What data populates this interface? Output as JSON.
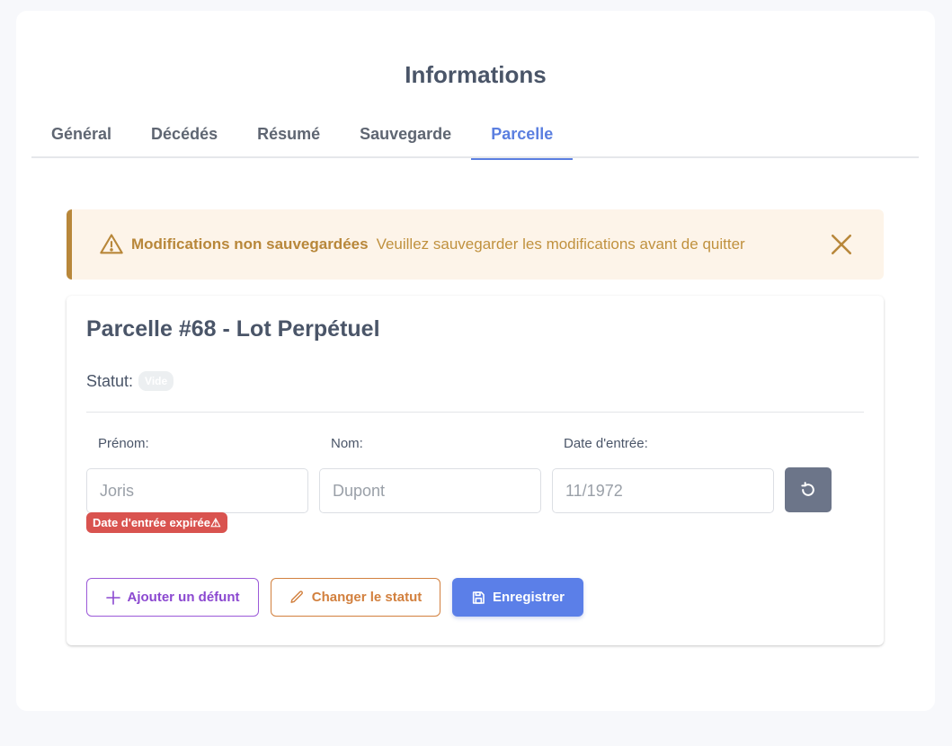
{
  "header": {
    "title": "Informations"
  },
  "tabs": [
    {
      "label": "Général"
    },
    {
      "label": "Décédés"
    },
    {
      "label": "Résumé"
    },
    {
      "label": "Sauvegarde"
    },
    {
      "label": "Parcelle"
    }
  ],
  "active_tab": "Parcelle",
  "alert": {
    "title": "Modifications non sauvegardées",
    "message": "Veuillez sauvegarder les modifications avant de quitter",
    "icon": "warning-triangle-icon",
    "close_icon": "close-icon",
    "color": "#b8873a",
    "background": "#fdf4e9"
  },
  "parcel": {
    "title": "Parcelle #68 - Lot Perpétuel",
    "status_label": "Statut:",
    "status_value": "Vide",
    "fields": {
      "first_name": {
        "label": "Prénom:",
        "value": "Joris"
      },
      "last_name": {
        "label": "Nom:",
        "value": "Dupont"
      },
      "entry_date": {
        "label": "Date d'entrée:",
        "value": "11/1972"
      }
    },
    "reset_icon": "reset-icon",
    "expired_badge": "Date d'entrée expirée⚠"
  },
  "actions": {
    "add_label": "Ajouter un défunt",
    "change_status_label": "Changer le statut",
    "save_label": "Enregistrer"
  },
  "colors": {
    "accent": "#5b7fe0",
    "purple": "#8b48d0",
    "orange": "#d2803e",
    "danger": "#d9534f"
  }
}
